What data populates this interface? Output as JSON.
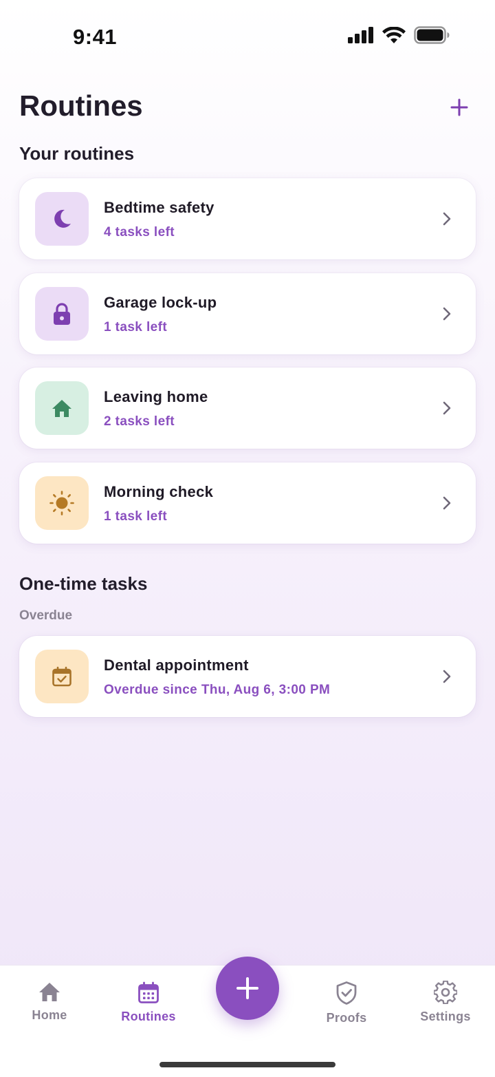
{
  "status_bar": {
    "time": "9:41"
  },
  "header": {
    "title": "Routines"
  },
  "sections": {
    "routines_title": "Your routines",
    "one_time_title": "One-time tasks",
    "overdue_label": "Overdue"
  },
  "routines": [
    {
      "title": "Bedtime safety",
      "subtitle": "4 tasks left",
      "icon": "moon-icon",
      "tile_color": "#ebdcf6",
      "icon_color": "#7d3fb0"
    },
    {
      "title": "Garage lock-up",
      "subtitle": "1 task left",
      "icon": "lock-icon",
      "tile_color": "#ebdcf6",
      "icon_color": "#7d3fb0"
    },
    {
      "title": "Leaving home",
      "subtitle": "2 tasks left",
      "icon": "home-icon",
      "tile_color": "#d7efe2",
      "icon_color": "#3c8a62"
    },
    {
      "title": "Morning check",
      "subtitle": "1 task left",
      "icon": "sun-icon",
      "tile_color": "#fde6c3",
      "icon_color": "#b57a25"
    }
  ],
  "tasks": [
    {
      "title": "Dental appointment",
      "subtitle": "Overdue since Thu, Aug 6, 3:00 PM",
      "icon": "calendar-check-icon",
      "tile_color": "#fde6c3",
      "icon_color": "#a8742a"
    }
  ],
  "tabs": [
    {
      "label": "Home",
      "icon": "home-icon",
      "active": false
    },
    {
      "label": "Routines",
      "icon": "calendar-icon",
      "active": true
    },
    {
      "label": "Proofs",
      "icon": "shield-check-icon",
      "active": false
    },
    {
      "label": "Settings",
      "icon": "gear-icon",
      "active": false
    }
  ],
  "colors": {
    "accent": "#8a4fbf",
    "muted": "#8a8392",
    "text": "#1f1a26"
  }
}
